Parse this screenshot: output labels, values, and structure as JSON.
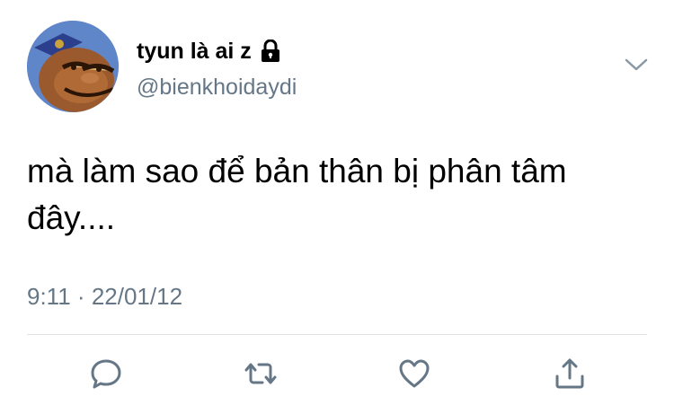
{
  "tweet": {
    "display_name": "tyun là ai z",
    "handle": "@bienkhoidaydi",
    "text": "mà làm sao để bản thân bị phân tâm đây....",
    "time": "9:11",
    "separator": "·",
    "date": "22/01/12"
  },
  "icons": {
    "lock": "lock-icon",
    "menu": "chevron-down-icon",
    "reply": "reply-icon",
    "retweet": "retweet-icon",
    "like": "heart-icon",
    "share": "share-icon"
  },
  "colors": {
    "text": "#000000",
    "secondary": "#657786",
    "icon": "#657786",
    "divider": "#dfe3e6"
  }
}
